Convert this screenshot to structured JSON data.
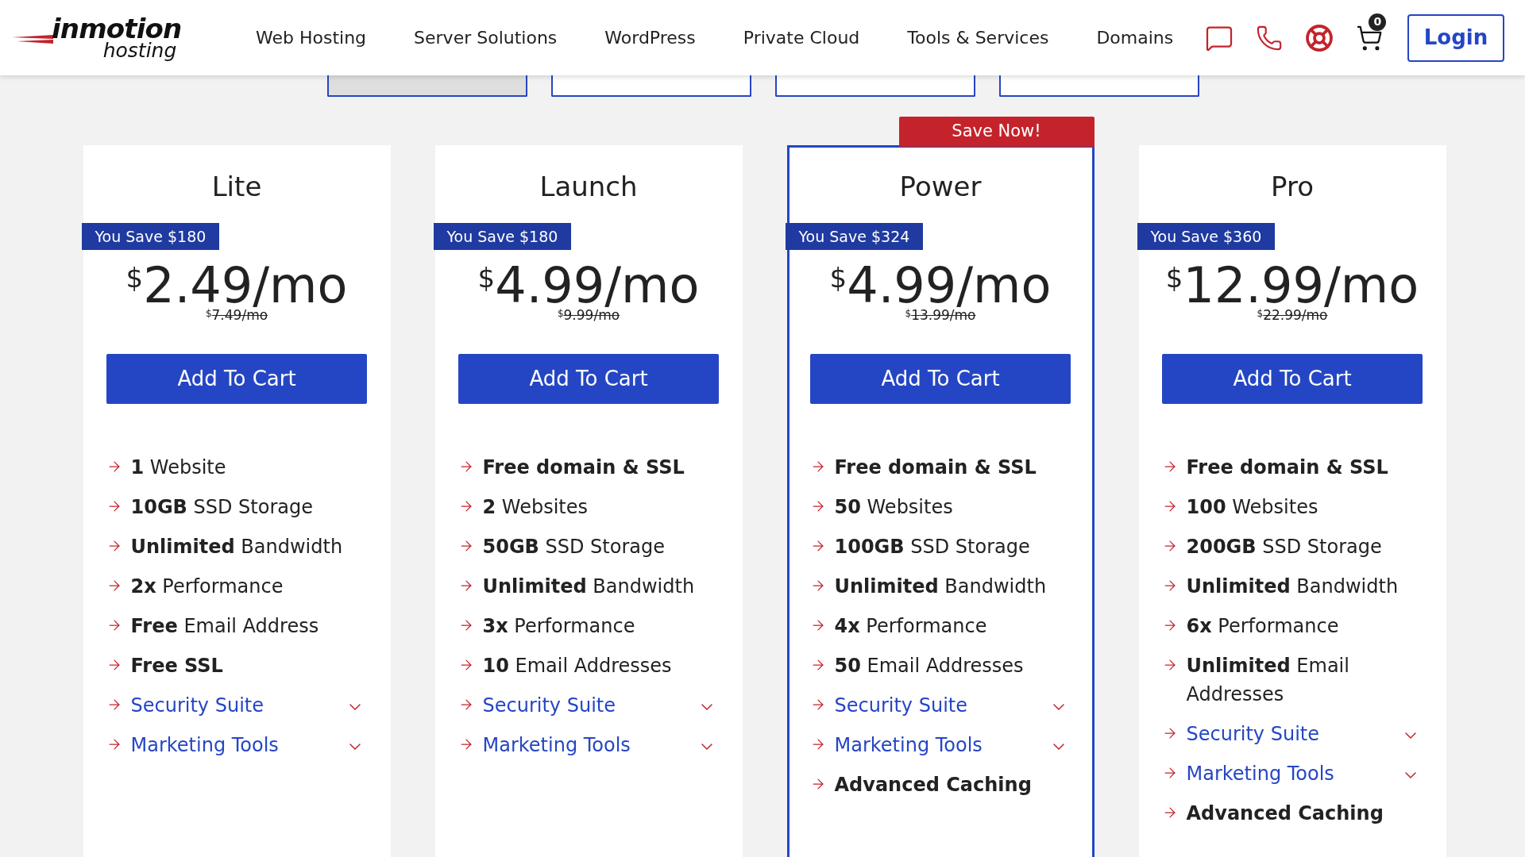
{
  "header": {
    "logo": {
      "brand": "inmotion",
      "sub": "hosting"
    },
    "nav": [
      "Web Hosting",
      "Server Solutions",
      "WordPress",
      "Private Cloud",
      "Tools & Services",
      "Domains"
    ],
    "cart_count": "0",
    "login": "Login"
  },
  "term_tabs": [
    {
      "selected": true
    },
    {
      "selected": false
    },
    {
      "selected": false
    },
    {
      "selected": false
    }
  ],
  "plans": [
    {
      "name": "Lite",
      "highlighted": false,
      "savings": "You Save $180",
      "currency": "$",
      "price": "2.49/mo",
      "old_currency": "$",
      "old_price": "7.49/mo",
      "button": "Add To Cart",
      "features": [
        {
          "kind": "text",
          "text": "**1** Website"
        },
        {
          "kind": "text",
          "text": "**10GB** SSD Storage"
        },
        {
          "kind": "text",
          "text": "**Unlimited** Bandwidth"
        },
        {
          "kind": "text",
          "text": "**2x** Performance"
        },
        {
          "kind": "text",
          "text": "**Free** Email Address"
        },
        {
          "kind": "text",
          "text": "**Free SSL**"
        },
        {
          "kind": "dropdown",
          "text": "Security Suite",
          "expanded": false
        },
        {
          "kind": "dropdown",
          "text": "Marketing Tools",
          "expanded": false
        }
      ]
    },
    {
      "name": "Launch",
      "highlighted": false,
      "savings": "You Save $180",
      "currency": "$",
      "price": "4.99/mo",
      "old_currency": "$",
      "old_price": "9.99/mo",
      "button": "Add To Cart",
      "features": [
        {
          "kind": "text",
          "text": "**Free domain & SSL**"
        },
        {
          "kind": "text",
          "text": "**2** Websites"
        },
        {
          "kind": "text",
          "text": "**50GB** SSD Storage"
        },
        {
          "kind": "text",
          "text": "**Unlimited** Bandwidth"
        },
        {
          "kind": "text",
          "text": "**3x** Performance"
        },
        {
          "kind": "text",
          "text": "**10** Email Addresses"
        },
        {
          "kind": "dropdown",
          "text": "Security Suite",
          "expanded": false
        },
        {
          "kind": "dropdown",
          "text": "Marketing Tools",
          "expanded": false
        }
      ]
    },
    {
      "name": "Power",
      "highlighted": true,
      "ribbon": "Save Now!",
      "savings": "You Save $324",
      "currency": "$",
      "price": "4.99/mo",
      "old_currency": "$",
      "old_price": "13.99/mo",
      "button": "Add To Cart",
      "features": [
        {
          "kind": "text",
          "text": "**Free domain & SSL**"
        },
        {
          "kind": "text",
          "text": "**50** Websites"
        },
        {
          "kind": "text",
          "text": "**100GB** SSD Storage"
        },
        {
          "kind": "text",
          "text": "**Unlimited** Bandwidth"
        },
        {
          "kind": "text",
          "text": "**4x** Performance"
        },
        {
          "kind": "text",
          "text": "**50** Email Addresses"
        },
        {
          "kind": "dropdown",
          "text": "Security Suite",
          "expanded": false
        },
        {
          "kind": "dropdown",
          "text": "Marketing Tools",
          "expanded": false
        },
        {
          "kind": "text",
          "text": "**Advanced Caching**"
        }
      ]
    },
    {
      "name": "Pro",
      "highlighted": false,
      "savings": "You Save $360",
      "currency": "$",
      "price": "12.99/mo",
      "old_currency": "$",
      "old_price": "22.99/mo",
      "button": "Add To Cart",
      "features": [
        {
          "kind": "text",
          "text": "**Free domain & SSL**"
        },
        {
          "kind": "text",
          "text": "**100** Websites"
        },
        {
          "kind": "text",
          "text": "**200GB** SSD Storage"
        },
        {
          "kind": "text",
          "text": "**Unlimited** Bandwidth"
        },
        {
          "kind": "text",
          "text": "**6x** Performance"
        },
        {
          "kind": "text",
          "text": "**Unlimited** Email Addresses"
        },
        {
          "kind": "dropdown",
          "text": "Security Suite",
          "expanded": false
        },
        {
          "kind": "dropdown",
          "text": "Marketing Tools",
          "expanded": false
        },
        {
          "kind": "text",
          "text": "**Advanced Caching**"
        }
      ]
    }
  ]
}
